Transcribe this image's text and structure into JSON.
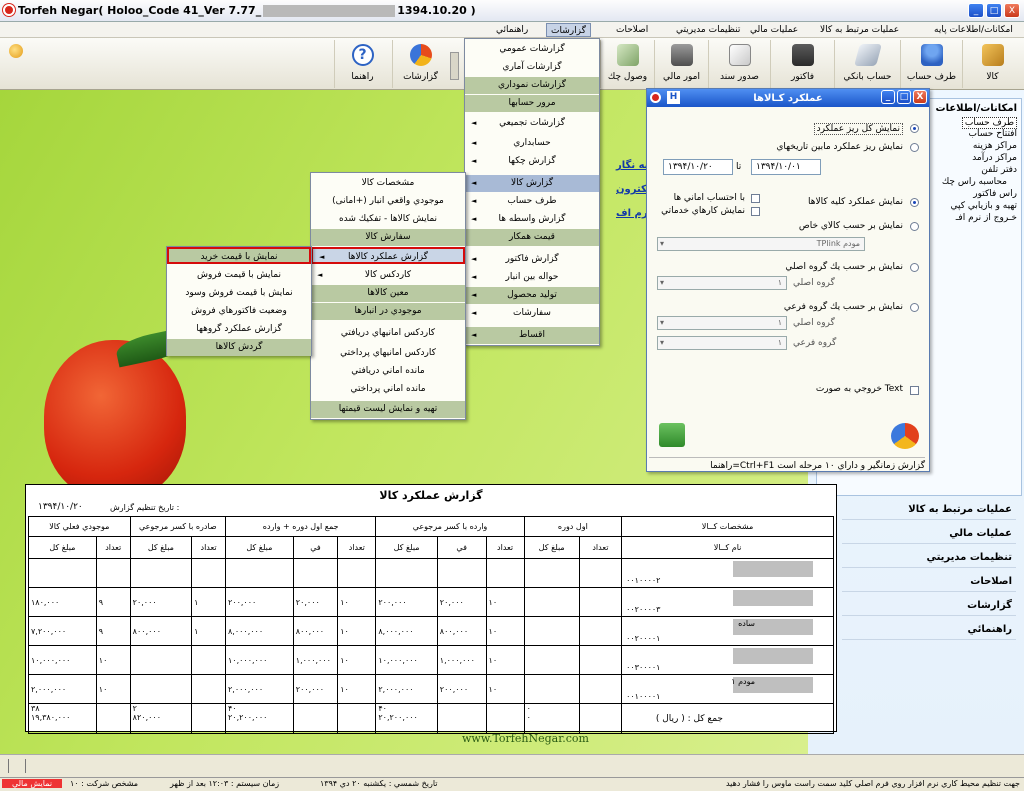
{
  "window": {
    "title": "Torfeh Negar( Holoo_Code 41_Ver 7.77_",
    "title_date": "1394.10.20 )",
    "minimize": "_",
    "maximize": "□",
    "close": "X"
  },
  "menu": [
    "امکانات/اطلاعات پایه",
    "عملیات مرتبط به کالا",
    "عملیات مالي",
    "تنظیمات مدیریتي",
    "اصلاحات",
    "گزارشات",
    "راهنمائي"
  ],
  "toolbar": [
    "کالا",
    "طرف حساب",
    "حساب بانکي",
    "فاکتور",
    "صدور سند",
    "امور مالي",
    "وصول چك",
    "گزارشات",
    "راهنما"
  ],
  "reports_menu": [
    "گزارشات عمومي",
    "گزارشات آماري",
    "گزارشات نموداري",
    "مرور حسابها",
    "گزارشات تجميعي",
    "حسابداري",
    "گزارش چکها",
    "گزارش کالا",
    "طرف حساب",
    "گزارش واسطه ها",
    "قيمت همکار",
    "گزارش فاکتور",
    "حواله بين انبار",
    "توليد محصول",
    "سفارشات",
    "اقساط"
  ],
  "kala_menu": [
    "مشخصات کالا",
    "موجودي واقعي انبار (+امانی)",
    "نمايش کالاها - تفکيك شده",
    "سفارش کالا",
    "گزارش عملكرد کالاها",
    "کاردکس کالا",
    "معين کالاها",
    "موجودي در انبارها",
    "کاردکس امانيهاي دريافتي",
    "کاردکس امانيهاي پرداختي",
    "مانده اماني دريافتي",
    "مانده اماني پرداختي",
    "تهيه و نمايش ليست قيمتها"
  ],
  "amalkard_menu": [
    "نمايش با قيمت خريد",
    "نمايش با قيمت فروش",
    "نمايش با قيمت فروش وسود",
    "وضعيت فاكتورهاي فروش",
    "گزارش عملكرد گروهها",
    "گردش کالاها"
  ],
  "desktop_links": [
    "نه نگار",
    "ت الکترون",
    "نال نرم اف"
  ],
  "dialog": {
    "title": "عملکرد کـالاها",
    "opt1": "نمايش کل ريز عملکرد",
    "opt2": "نمايش ريز عملکرد مابين تاريخهاي",
    "date_from": "۱۳۹۴/۱۰/۰۱",
    "date_to": "۱۳۹۴/۱۰/۲۰",
    "date_sep": "تا",
    "opt3": "نمايش عملکرد کليه کالاها",
    "chk1": "با احتساب اماني ها",
    "chk2": "نمايش کارهاي خدماتي",
    "opt4": "نمايش بر حسب کالاي خاص",
    "item_combo": "TPlink مودم",
    "opt5": "نمايش بر حسب يك گروه اصلي",
    "main_group": "گروه اصلي",
    "combo_one": "۱",
    "opt6": "نمايش بر حسب يك گروه فرعي",
    "sub_group": "گروه فرعي",
    "export": "خروجي به صورت Text",
    "status": "راهنما=Ctrl+F1    گزارش زمانگير و داراي ۱۰ مرحله است"
  },
  "side_tree": [
    "امکانات/اطلاعات",
    "طرف حساب",
    "افتتاح حساب",
    "مراکز هزينه",
    "مراکز درآمد",
    "دفتر تلفن",
    "محاسبه راس چك",
    "راس فاکتور",
    "تهيه و بازيابي كپي",
    "خـروج از نرم افـ"
  ],
  "side_nav": [
    "عمليات مرتبط به كالا",
    "عمليات مالي",
    "تنظيمات مديريتي",
    "اصلاحات",
    "گزارشات",
    "راهنمائي"
  ],
  "report": {
    "title": "گزارش عملکرد کالا",
    "date_label": "تاريخ تنظيم گزارش :",
    "date": "۱۳۹۴/۱۰/۲۰",
    "groups": [
      "مشخصات كــالا",
      "اول دوره",
      "وارده با کسر مرجوعي",
      "جمع اول دوره + وارده",
      "صادره با کسر مرجوعي",
      "موجودي فعلي کالا"
    ],
    "sub": {
      "name": "نام كــالا",
      "count": "تعداد",
      "price": "في",
      "total": "مبلغ كل"
    },
    "rows": [
      {
        "code": "۰۰۱۰۰۰۰۲",
        "name": "",
        "cells": [
          "",
          "",
          "",
          "",
          "",
          "",
          "",
          "",
          "",
          "",
          "",
          "",
          "",
          "",
          ""
        ]
      },
      {
        "code": "۰۰۲۰۰۰۰۳",
        "name": "",
        "cells": [
          "",
          "",
          "",
          "۱۰",
          "۲۰,۰۰۰",
          "۲۰۰,۰۰۰",
          "۱۰",
          "۲۰,۰۰۰",
          "۲۰۰,۰۰۰",
          "۱",
          "۲۰,۰۰۰",
          "۹",
          "۱۸۰,۰۰۰",
          "",
          ""
        ]
      },
      {
        "code": "۰۰۲۰۰۰۰۱",
        "name": "ساده",
        "cells": [
          "",
          "",
          "",
          "۱۰",
          "۸۰۰,۰۰۰",
          "۸,۰۰۰,۰۰۰",
          "۱۰",
          "۸۰۰,۰۰۰",
          "۸,۰۰۰,۰۰۰",
          "۱",
          "۸۰۰,۰۰۰",
          "۹",
          "۷,۲۰۰,۰۰۰",
          "",
          ""
        ]
      },
      {
        "code": "۰۰۳۰۰۰۰۱",
        "name": "",
        "cells": [
          "",
          "",
          "",
          "۱۰",
          "۱,۰۰۰,۰۰۰",
          "۱۰,۰۰۰,۰۰۰",
          "۱۰",
          "۱,۰۰۰,۰۰۰",
          "۱۰,۰۰۰,۰۰۰",
          "",
          "",
          "۱۰",
          "۱۰,۰۰۰,۰۰۰",
          "",
          ""
        ]
      },
      {
        "code": "۰۰۱۰۰۰۰۱",
        "name": "۱ مودم",
        "cells": [
          "",
          "",
          "",
          "۱۰",
          "۲۰۰,۰۰۰",
          "۲,۰۰۰,۰۰۰",
          "۱۰",
          "۲۰۰,۰۰۰",
          "۲,۰۰۰,۰۰۰",
          "",
          "",
          "۱۰",
          "۲,۰۰۰,۰۰۰",
          "",
          ""
        ]
      }
    ],
    "total_label": "جمع کل : ( ريال )",
    "totals": {
      "open": "۰",
      "open2": "۰",
      "in_count": "۴۰",
      "in_total": "۲۰,۲۰۰,۰۰۰",
      "sum_count": "۴۰",
      "sum_total": "۲۰,۲۰۰,۰۰۰",
      "out_count": "۲",
      "out_total": "۸۲۰,۰۰۰",
      "rem_count": "۳۸",
      "rem_total": "۱۹,۳۸۰,۰۰۰"
    }
  },
  "watermark": "www.TorfehNegar.com",
  "status": {
    "left": "نمايش مالي",
    "s2": "مشخص شركت : ۱۰",
    "s3": "زمان سيستم : ۱۲:۰۳ بعد از ظهر",
    "s4": "تاريخ شمسي : يکشنبه ۲۰ دي ۱۳۹۴",
    "right": "جهت تنظيم محيط كاري نرم افزار روي فرم اصلي کليد سمت راست ماوس را فشار دهيد"
  }
}
